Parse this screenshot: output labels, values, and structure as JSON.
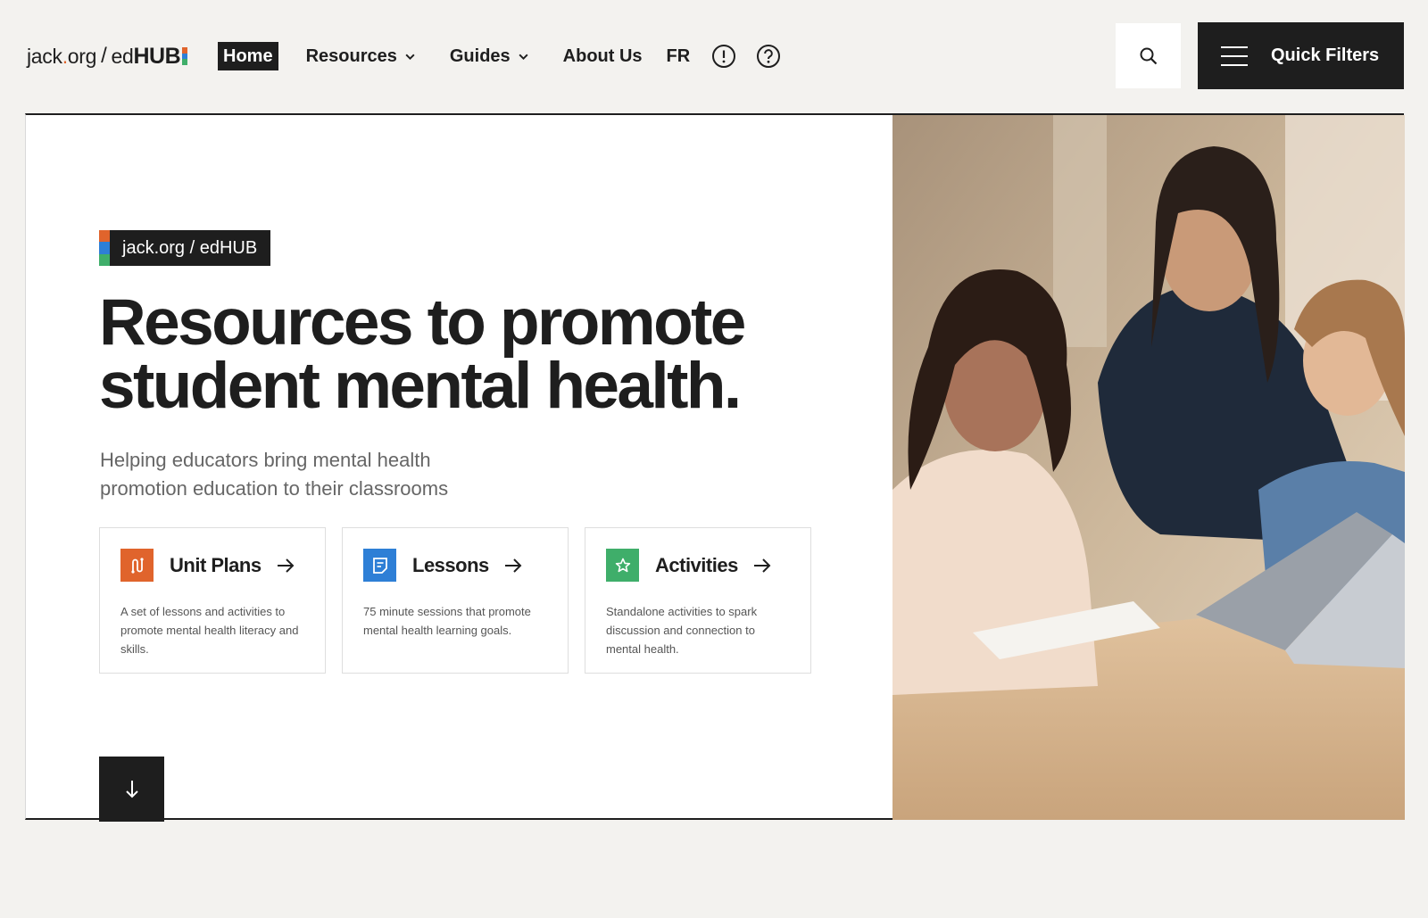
{
  "header": {
    "logo": {
      "part1": "jack",
      "dot": ".",
      "part2": "org",
      "slash": "/",
      "ed": "ed",
      "hub": "HUB"
    },
    "nav": {
      "home": "Home",
      "resources": "Resources",
      "guides": "Guides",
      "about": "About Us",
      "fr": "FR"
    },
    "quick_filters": "Quick Filters"
  },
  "hero": {
    "badge": "jack.org / edHUB",
    "headline_line1": "Resources to promote",
    "headline_line2": "student mental health.",
    "subhead_line1": "Helping educators bring mental health",
    "subhead_line2": "promotion education to their classrooms",
    "cards": [
      {
        "title": "Unit Plans",
        "description": "A set of lessons and activities to promote mental health literacy and skills.",
        "color": "#e0642c",
        "icon": "unit-plans-icon"
      },
      {
        "title": "Lessons",
        "description": "75 minute sessions that promote mental health learning goals.",
        "color": "#2e7fd6",
        "icon": "lessons-icon"
      },
      {
        "title": "Activities",
        "description": "Standalone activities to spark discussion and connection to mental health.",
        "color": "#3fae6a",
        "icon": "star-icon"
      }
    ]
  },
  "colors": {
    "brand_orange": "#e0642c",
    "brand_blue": "#2e7fd6",
    "brand_green": "#3fae6a",
    "dark": "#1e1e1e",
    "background": "#f3f2ef"
  }
}
